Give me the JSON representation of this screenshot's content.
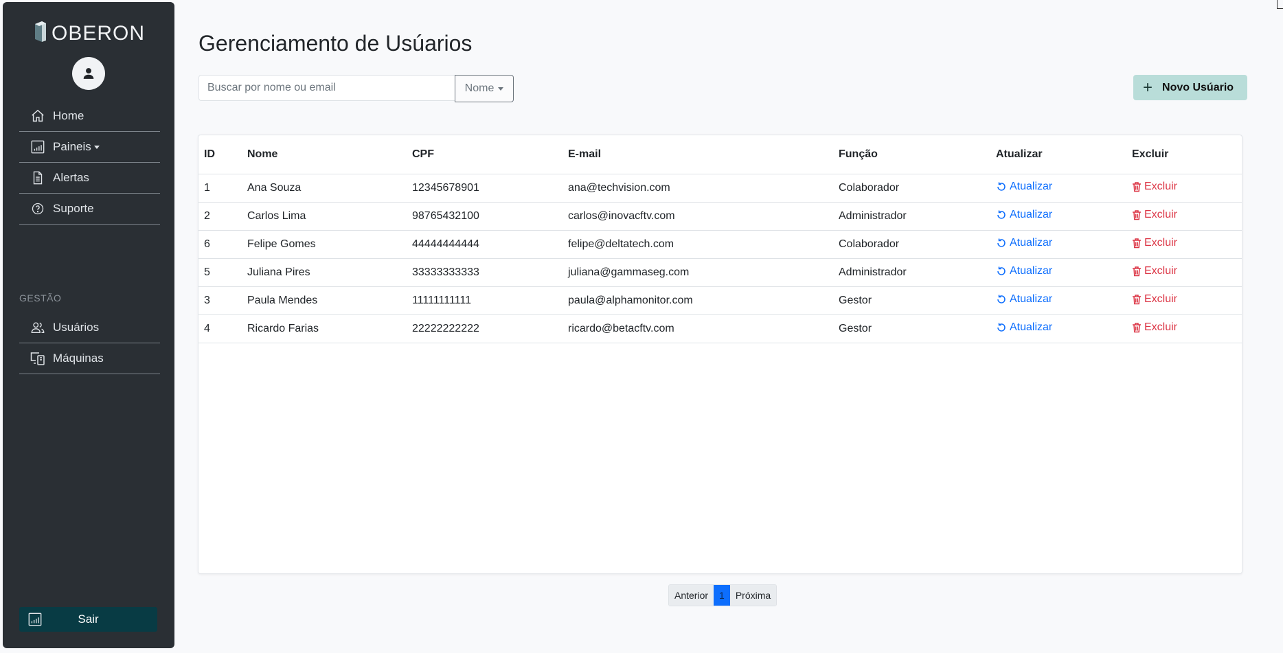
{
  "sidebar": {
    "logo_text": "OBERON",
    "nav": [
      {
        "label": "Home",
        "icon": "home-icon"
      },
      {
        "label": "Paineis",
        "icon": "bar-chart-icon"
      },
      {
        "label": "Alertas",
        "icon": "document-icon"
      },
      {
        "label": "Suporte",
        "icon": "question-icon"
      }
    ],
    "section_label": "GESTÃO",
    "management": [
      {
        "label": "Usuários",
        "icon": "users-icon"
      },
      {
        "label": "Máquinas",
        "icon": "devices-icon"
      }
    ],
    "logout_label": "Sair"
  },
  "main": {
    "title": "Gerenciamento de Usúarios",
    "search_placeholder": "Buscar por nome ou email",
    "filter_label": "Nome",
    "new_user_label": "Novo Usúario"
  },
  "table": {
    "headers": [
      "ID",
      "Nome",
      "CPF",
      "E-mail",
      "Função",
      "Atualizar",
      "Excluir"
    ],
    "rows": [
      {
        "id": "1",
        "name": "Ana Souza",
        "cpf": "12345678901",
        "email": "ana@techvision.com",
        "role": "Colaborador",
        "update": "Atualizar",
        "delete": "Excluir"
      },
      {
        "id": "2",
        "name": "Carlos Lima",
        "cpf": "98765432100",
        "email": "carlos@inovacftv.com",
        "role": "Administrador",
        "update": "Atualizar",
        "delete": "Excluir"
      },
      {
        "id": "6",
        "name": "Felipe Gomes",
        "cpf": "44444444444",
        "email": "felipe@deltatech.com",
        "role": "Colaborador",
        "update": "Atualizar",
        "delete": "Excluir"
      },
      {
        "id": "5",
        "name": "Juliana Pires",
        "cpf": "33333333333",
        "email": "juliana@gammaseg.com",
        "role": "Administrador",
        "update": "Atualizar",
        "delete": "Excluir"
      },
      {
        "id": "3",
        "name": "Paula Mendes",
        "cpf": "11111111111",
        "email": "paula@alphamonitor.com",
        "role": "Gestor",
        "update": "Atualizar",
        "delete": "Excluir"
      },
      {
        "id": "4",
        "name": "Ricardo Farias",
        "cpf": "22222222222",
        "email": "ricardo@betacftv.com",
        "role": "Gestor",
        "update": "Atualizar",
        "delete": "Excluir"
      }
    ]
  },
  "pagination": {
    "prev": "Anterior",
    "current": "1",
    "next": "Próxima"
  },
  "colors": {
    "sidebar_bg": "#2a2f34",
    "primary": "#0d6efd",
    "danger": "#dc3545",
    "new_button_bg": "#b9ddd9",
    "logout_bg": "#083b44"
  }
}
